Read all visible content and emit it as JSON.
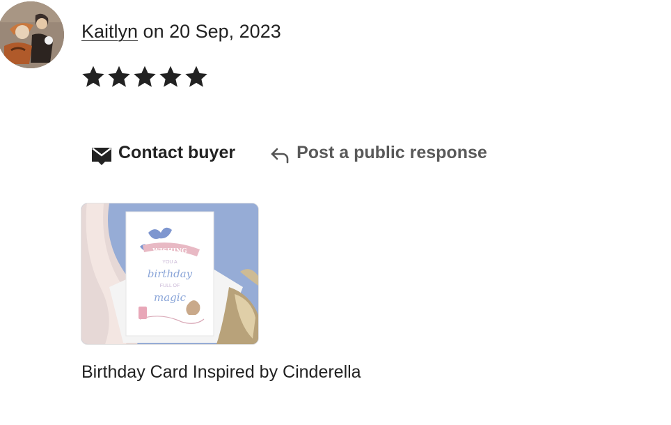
{
  "review": {
    "reviewer_name": "Kaitlyn",
    "date_text": " on 20 Sep, 2023",
    "rating": 5,
    "stars": [
      "★",
      "★",
      "★",
      "★",
      "★"
    ]
  },
  "actions": {
    "contact_label": "Contact buyer",
    "contact_icon": "envelope-icon",
    "respond_label": "Post a public response",
    "respond_icon": "reply-arrow-icon"
  },
  "product": {
    "title": "Birthday Card Inspired by Cinderella",
    "card_text": [
      "WISHING",
      "YOU A",
      "birthday",
      "FULL OF",
      "magic"
    ]
  },
  "colors": {
    "text": "#222222",
    "muted": "#595959",
    "card_blue": "#8fa6d2",
    "star": "#222222"
  }
}
